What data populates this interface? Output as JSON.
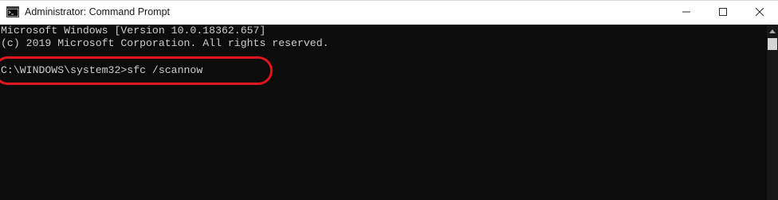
{
  "window": {
    "title": "Administrator: Command Prompt",
    "icon": "command-prompt-icon",
    "controls": {
      "minimize_icon": "minimize-icon",
      "maximize_icon": "maximize-icon",
      "close_icon": "close-icon"
    }
  },
  "console": {
    "lines": [
      "Microsoft Windows [Version 10.0.18362.657]",
      "(c) 2019 Microsoft Corporation. All rights reserved.",
      "",
      "C:\\WINDOWS\\system32>sfc /scannow"
    ],
    "prompt": "C:\\WINDOWS\\system32>",
    "command": "sfc /scannow",
    "text_color": "#cccccc",
    "background_color": "#0c0c0c"
  },
  "annotation": {
    "ring_color": "#e1151d"
  },
  "scrollbar": {
    "up_arrow_icon": "scroll-up-arrow-icon"
  }
}
